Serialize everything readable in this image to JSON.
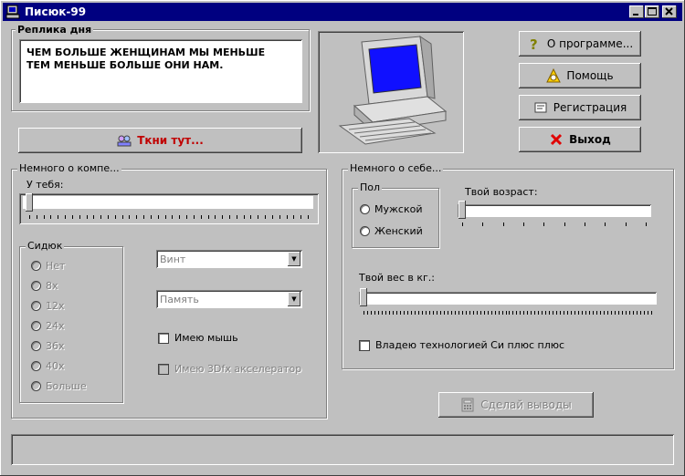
{
  "window": {
    "title": "Писюк-99"
  },
  "phrase": {
    "label": "Реплика дня",
    "line1": "ЧЕМ БОЛЬШЕ ЖЕНЩИНАМ МЫ МЕНЬШЕ",
    "line2": "ТЕМ МЕНЬШЕ БОЛЬШЕ ОНИ НАМ."
  },
  "poke_button": "Ткни тут...",
  "buttons": {
    "about": "О программе...",
    "help": "Помощь",
    "register": "Регистрация",
    "exit": "Выход"
  },
  "computer": {
    "label": "Немного о компе...",
    "you_have": "У тебя:",
    "you_have_value": 0,
    "sidiuk": {
      "label": "Сидюк",
      "options": [
        "Нет",
        "8x",
        "12x",
        "24x",
        "36x",
        "40x",
        "Больше"
      ]
    },
    "combo_vint": "Винт",
    "combo_memory": "Память",
    "have_mouse": "Имею мышь",
    "have_3dfx": "Имею 3Dfx акселератор"
  },
  "self": {
    "label": "Немного о себе...",
    "sex": {
      "label": "Пол",
      "male": "Мужской",
      "female": "Женский"
    },
    "age_label": "Твой возраст:",
    "age_value": 0,
    "weight_label": "Твой вес в кг.:",
    "weight_value": 0,
    "cpp": "Владею технологией Си плюс плюс"
  },
  "conclude_button": "Сделай выводы"
}
